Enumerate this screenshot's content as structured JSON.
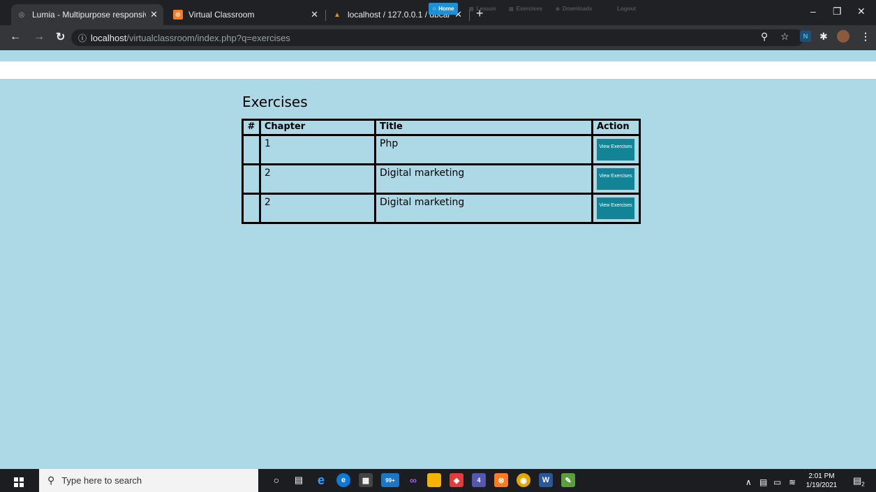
{
  "browser": {
    "tabs": [
      {
        "title": "Lumia - Multipurpose responsive",
        "active": true
      },
      {
        "title": "Virtual Classroom",
        "active": false
      },
      {
        "title": "localhost / 127.0.0.1 / dbcaiwl / t",
        "active": false
      }
    ],
    "address": {
      "host": "localhost",
      "path": "/virtualclassroom/index.php?q=exercises"
    }
  },
  "nav": {
    "home": "Home",
    "lesson": "Lesson",
    "exercises": "Exercises",
    "downloads": "Downloads",
    "logout": "Logout"
  },
  "main": {
    "title": "Exercises",
    "table": {
      "headers": [
        "#",
        "Chapter",
        "Title",
        "Action"
      ],
      "rows": [
        {
          "num": "",
          "chapter": "1",
          "title": "Php",
          "action": "View Exercises"
        },
        {
          "num": "",
          "chapter": "2",
          "title": "Digital marketing",
          "action": "View Exercises"
        },
        {
          "num": "",
          "chapter": "2",
          "title": "Digital marketing",
          "action": "View Exercises"
        }
      ]
    }
  },
  "taskbar": {
    "search_placeholder": "Type here to search",
    "store_badge": "99+",
    "teams_badge": "4",
    "notification_count": "2",
    "time": "2:01 PM",
    "date": "1/19/2021"
  },
  "colors": {
    "page_bg": "#add8e6",
    "nav_active": "#1e90d6",
    "button": "#138496"
  }
}
